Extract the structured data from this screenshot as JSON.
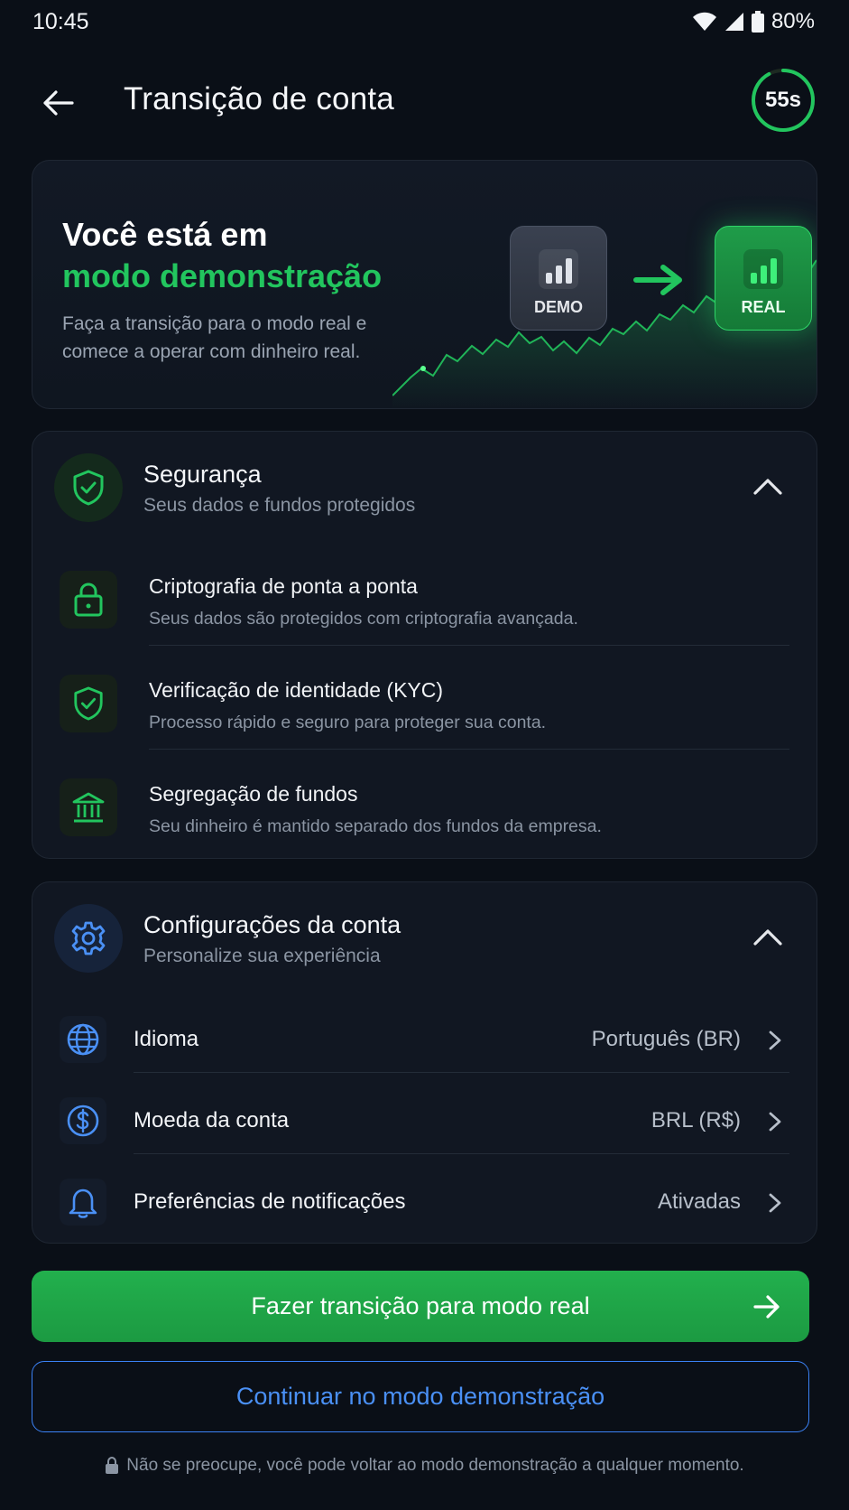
{
  "status_bar": {
    "time": "10:45",
    "battery": "80%"
  },
  "header": {
    "title": "Transição de conta",
    "timer": "55s",
    "timer_progress": 0.92
  },
  "hero": {
    "title_line1": "Você está em",
    "title_line2": "modo demonstração",
    "description": "Faça a transição para o modo real e comece a operar com dinheiro real.",
    "demo_label": "DEMO",
    "real_label": "REAL"
  },
  "security": {
    "title": "Segurança",
    "subtitle": "Seus dados e fundos protegidos",
    "items": [
      {
        "icon": "lock-icon",
        "title": "Criptografia de ponta a ponta",
        "desc": "Seus dados são protegidos com criptografia avançada."
      },
      {
        "icon": "shield-check-icon",
        "title": "Verificação de identidade (KYC)",
        "desc": "Processo rápido e seguro para proteger sua conta."
      },
      {
        "icon": "bank-icon",
        "title": "Segregação de fundos",
        "desc": "Seu dinheiro é mantido separado dos fundos da empresa."
      }
    ]
  },
  "settings": {
    "title": "Configurações da conta",
    "subtitle": "Personalize sua experiência",
    "rows": [
      {
        "icon": "globe-icon",
        "label": "Idioma",
        "value": "Português (BR)"
      },
      {
        "icon": "dollar-icon",
        "label": "Moeda da conta",
        "value": "BRL (R$)"
      },
      {
        "icon": "bell-icon",
        "label": "Preferências de notificações",
        "value": "Ativadas"
      }
    ]
  },
  "actions": {
    "primary": "Fazer transição para modo real",
    "secondary": "Continuar no modo demonstração"
  },
  "footer_note": "Não se preocupe, você pode voltar ao modo demonstração a qualquer momento.",
  "colors": {
    "accent_green": "#22c55e",
    "accent_blue": "#3b82f6",
    "background": "#0a0f17",
    "card": "#111722"
  }
}
